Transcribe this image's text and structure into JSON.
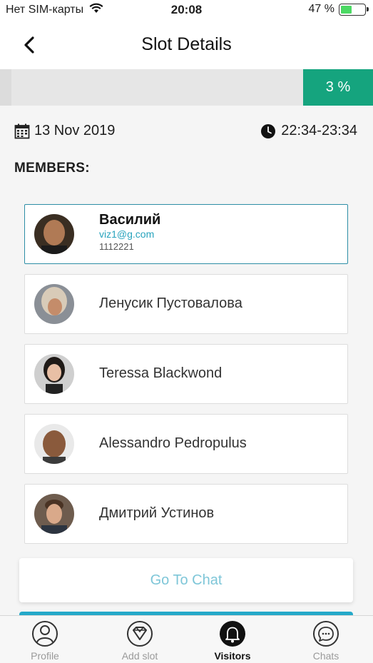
{
  "status_bar": {
    "carrier": "Нет SIM-карты",
    "time": "20:08",
    "battery": "47 %",
    "battery_level": 0.47
  },
  "nav": {
    "back_icon": "chevron-left-icon",
    "title": "Slot Details"
  },
  "progress": {
    "label": "3 %",
    "value": 0.03,
    "badge_color": "#15a47e"
  },
  "slot": {
    "date": "13 Nov 2019",
    "time_range": "22:34-23:34"
  },
  "members_title": "MEMBERS:",
  "members": [
    {
      "name": "Василий",
      "email": "viz1@g.com",
      "phone": "1112221",
      "selected": true
    },
    {
      "name": "Ленусик Пустовалова"
    },
    {
      "name": "Teressa Blackwond"
    },
    {
      "name": "Alessandro Pedropulus"
    },
    {
      "name": "Дмитрий Устинов"
    }
  ],
  "chat_button": "Go To Chat",
  "tabs": [
    {
      "label": "Profile",
      "icon": "person-icon",
      "active": false
    },
    {
      "label": "Add slot",
      "icon": "add-slot-icon",
      "active": false
    },
    {
      "label": "Visitors",
      "icon": "bell-icon",
      "active": true
    },
    {
      "label": "Chats",
      "icon": "chat-bubble-icon",
      "active": false
    }
  ],
  "colors": {
    "accent": "#15a47e",
    "link": "#27a3bd",
    "selected_border": "#2d8ea6"
  }
}
